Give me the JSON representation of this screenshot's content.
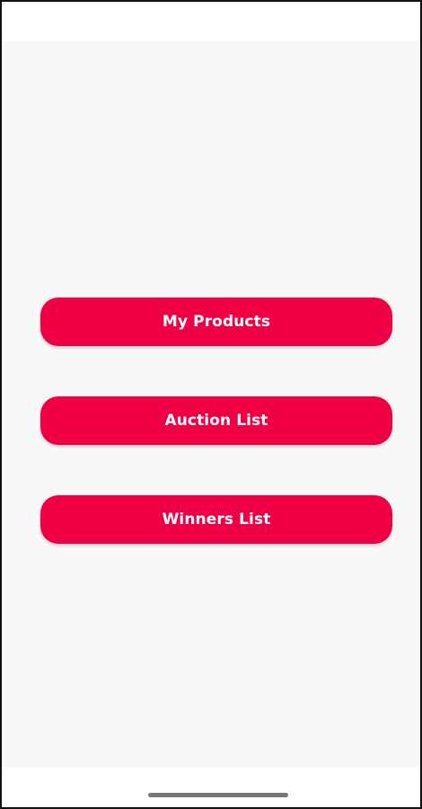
{
  "colors": {
    "accent": "#ef0045",
    "background": "#f8f8f8",
    "button_text": "#ffffff"
  },
  "menu": {
    "buttons": [
      {
        "label": "My Products"
      },
      {
        "label": "Auction List"
      },
      {
        "label": "Winners List"
      }
    ]
  }
}
